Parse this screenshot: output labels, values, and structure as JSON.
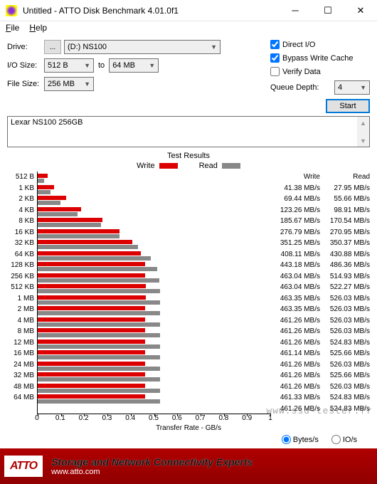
{
  "window": {
    "title": "Untitled - ATTO Disk Benchmark 4.01.0f1"
  },
  "menu": {
    "file": "File",
    "help": "Help"
  },
  "controls": {
    "drive_label": "Drive:",
    "drive_value": "(D:) NS100",
    "io_label": "I/O Size:",
    "io_from": "512 B",
    "io_to_label": "to",
    "io_to": "64 MB",
    "filesize_label": "File Size:",
    "filesize": "256 MB",
    "direct_io": "Direct I/O",
    "bypass": "Bypass Write Cache",
    "verify": "Verify Data",
    "qd_label": "Queue Depth:",
    "qd_value": "4",
    "start": "Start"
  },
  "description": "Lexar NS100 256GB",
  "results_title": "Test Results",
  "legend": {
    "write": "Write",
    "read": "Read"
  },
  "xlabel": "Transfer Rate - GB/s",
  "xticks": [
    "0",
    "0.1",
    "0.2",
    "0.3",
    "0.4",
    "0.5",
    "0.6",
    "0.7",
    "0.8",
    "0.9",
    "1"
  ],
  "values_hdr": {
    "write": "Write",
    "read": "Read"
  },
  "unit_bytes": "Bytes/s",
  "unit_io": "IO/s",
  "footer": {
    "logo": "ATTO",
    "tagline": "Storage and Network Connectivity Experts",
    "url": "www.atto.com"
  },
  "watermark": "www.ssd-tester.fr",
  "chart_data": {
    "type": "bar",
    "title": "Test Results",
    "xlabel": "Transfer Rate - GB/s",
    "ylabel": "I/O Size",
    "xlim": [
      0,
      1
    ],
    "categories": [
      "512 B",
      "1 KB",
      "2 KB",
      "4 KB",
      "8 KB",
      "16 KB",
      "32 KB",
      "64 KB",
      "128 KB",
      "256 KB",
      "512 KB",
      "1 MB",
      "2 MB",
      "4 MB",
      "8 MB",
      "12 MB",
      "16 MB",
      "24 MB",
      "32 MB",
      "48 MB",
      "64 MB"
    ],
    "series": [
      {
        "name": "Write",
        "unit": "MB/s",
        "values": [
          41.38,
          69.44,
          123.26,
          185.67,
          276.79,
          351.25,
          408.11,
          443.18,
          463.04,
          463.04,
          463.35,
          463.35,
          461.26,
          461.26,
          461.26,
          461.14,
          461.26,
          461.26,
          461.26,
          461.33,
          461.26
        ]
      },
      {
        "name": "Read",
        "unit": "MB/s",
        "values": [
          27.95,
          55.66,
          98.91,
          170.54,
          270.95,
          350.37,
          430.88,
          486.36,
          514.93,
          522.27,
          526.03,
          526.03,
          526.03,
          526.03,
          524.83,
          525.66,
          526.03,
          525.66,
          526.03,
          524.83,
          524.83
        ]
      }
    ]
  }
}
